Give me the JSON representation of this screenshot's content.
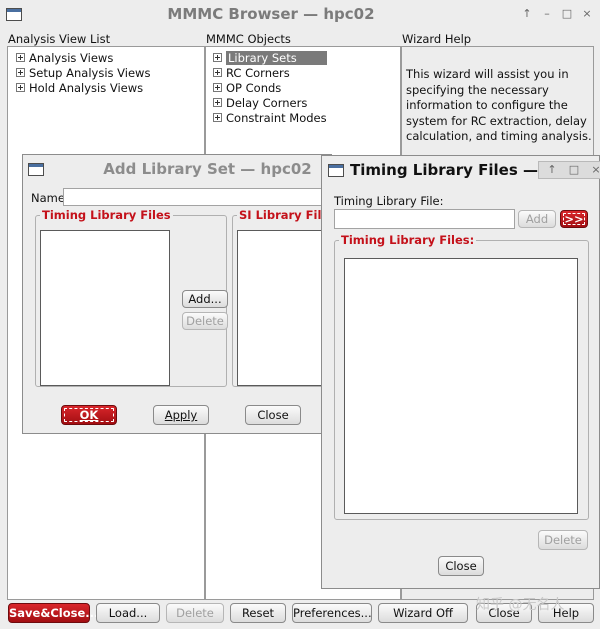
{
  "main": {
    "title": "MMMC Browser — hpc02",
    "title_buttons": [
      "↑",
      "–",
      "□",
      "×"
    ],
    "headers": {
      "analysis": "Analysis View List",
      "objects": "MMMC Objects",
      "wizard": "Wizard Help"
    },
    "analysis_items": [
      "Analysis Views",
      "Setup Analysis Views",
      "Hold Analysis Views"
    ],
    "object_items": [
      "Library Sets",
      "RC Corners",
      "OP Conds",
      "Delay Corners",
      "Constraint Modes"
    ],
    "wizard_help": "This wizard will assist you in specifying the necessary information to configure the system for RC extraction, delay calculation, and timing analysis.",
    "bottom_buttons": {
      "save_close": "Save&Close...",
      "load": "Load...",
      "delete": "Delete",
      "reset": "Reset",
      "preferences": "Preferences...",
      "wizard_off": "Wizard Off",
      "close": "Close",
      "help": "Help"
    }
  },
  "add_lib": {
    "title": "Add Library Set — hpc02",
    "name_label": "Name:",
    "name_value": "",
    "timing_group": "Timing Library Files",
    "si_group": "SI Library Files",
    "add": "Add...",
    "delete": "Delete",
    "ok": "OK",
    "apply": "Apply",
    "close": "Close"
  },
  "timing_lib": {
    "title": "Timing Library Files —",
    "title_buttons": [
      "↑",
      "□",
      "×"
    ],
    "file_label": "Timing Library File:",
    "file_value": "",
    "add": "Add",
    "arrow": ">>",
    "group": "Timing Library Files:",
    "delete": "Delete",
    "close": "Close"
  },
  "watermark": "知乎 @无名人"
}
